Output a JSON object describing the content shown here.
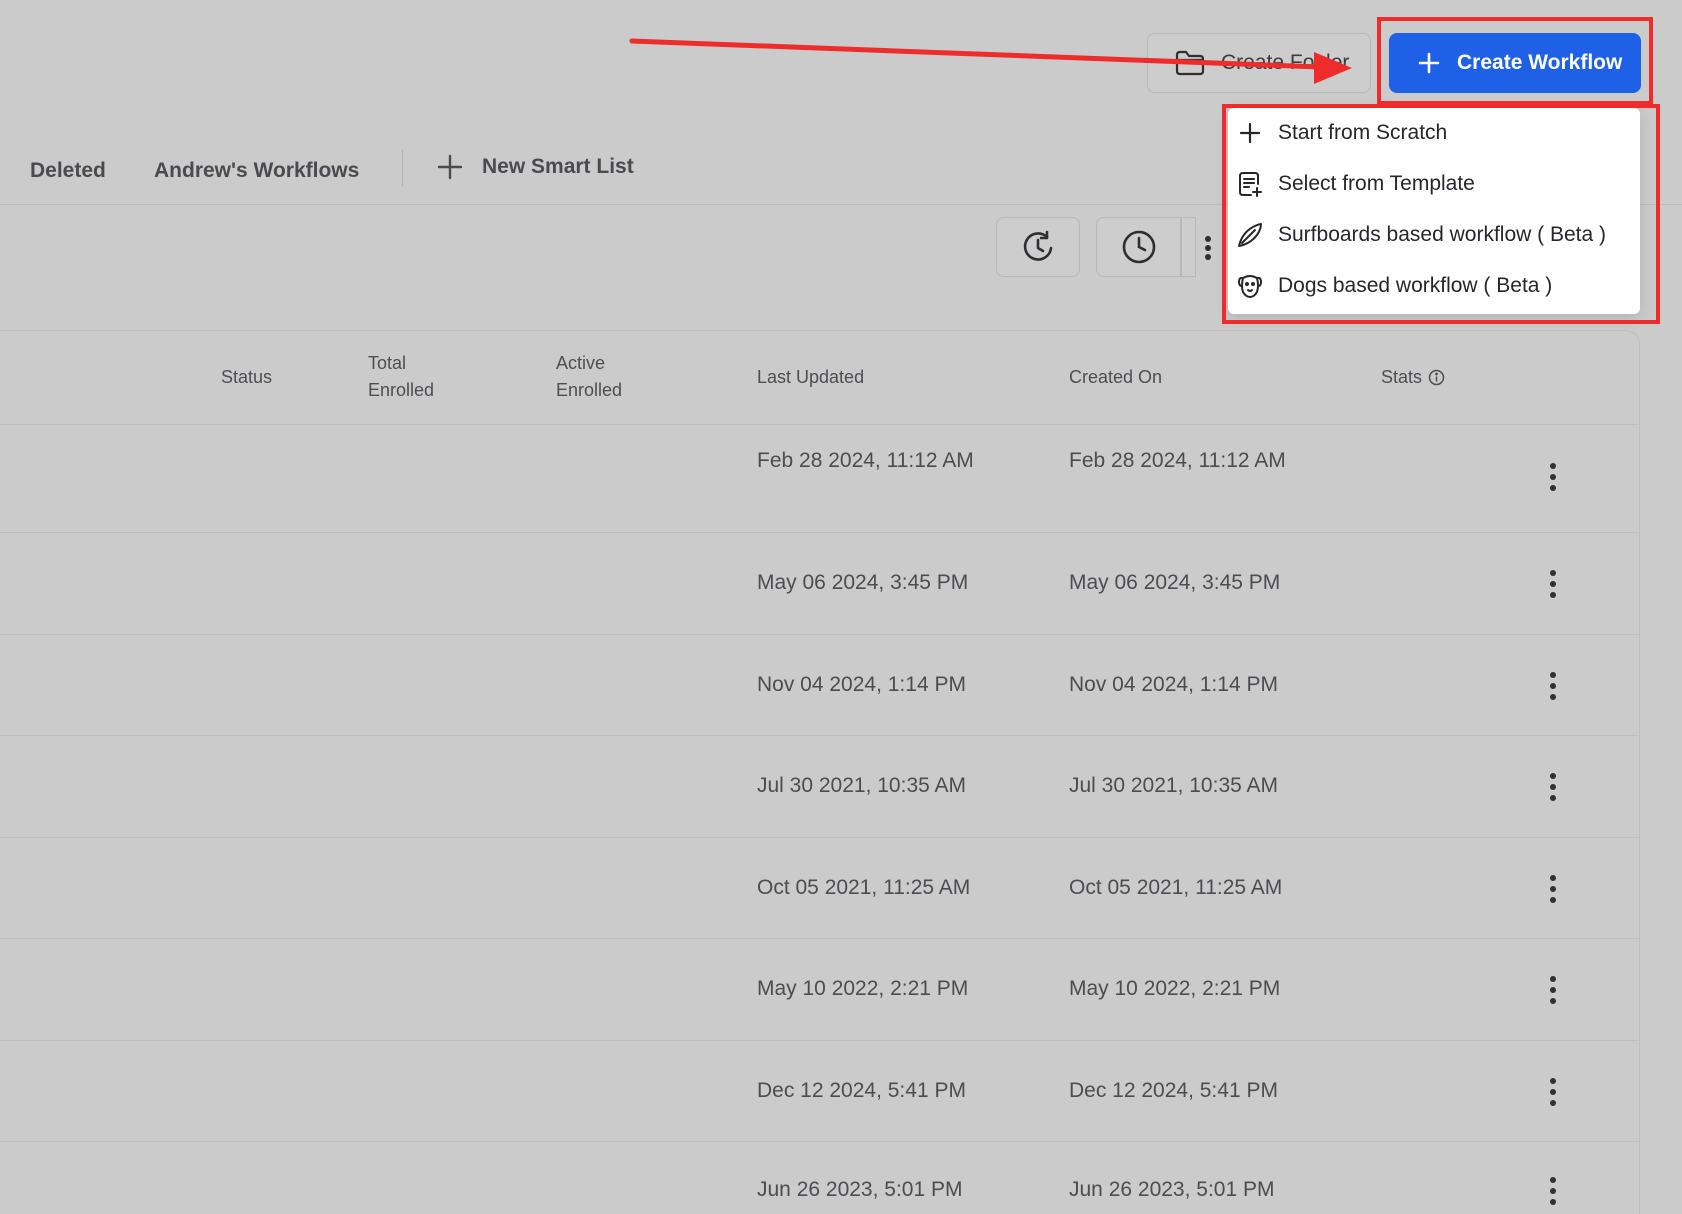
{
  "header": {
    "create_folder_label": "Create Folder",
    "create_workflow_label": "Create Workflow",
    "primary_color": "#1f61e6"
  },
  "tabs": {
    "items": [
      {
        "label": "Deleted"
      },
      {
        "label": "Andrew's Workflows"
      }
    ],
    "new_smart_list_label": "New Smart List"
  },
  "toolbar": {
    "icons": [
      "clock-refresh-icon",
      "clock-icon",
      "drag-handle-icon"
    ]
  },
  "table": {
    "columns": {
      "status": "Status",
      "total_enrolled_1": "Total",
      "total_enrolled_2": "Enrolled",
      "active_enrolled_1": "Active",
      "active_enrolled_2": "Enrolled",
      "last_updated": "Last Updated",
      "created_on": "Created On",
      "stats": "Stats"
    },
    "rows": [
      {
        "last_updated": "Feb 28 2024, 11:12 AM",
        "created_on": "Feb 28 2024, 11:12 AM"
      },
      {
        "last_updated": "May 06 2024, 3:45 PM",
        "created_on": "May 06 2024, 3:45 PM"
      },
      {
        "last_updated": "Nov 04 2024, 1:14 PM",
        "created_on": "Nov 04 2024, 1:14 PM"
      },
      {
        "last_updated": "Jul 30 2021, 10:35 AM",
        "created_on": "Jul 30 2021, 10:35 AM"
      },
      {
        "last_updated": "Oct 05 2021, 11:25 AM",
        "created_on": "Oct 05 2021, 11:25 AM"
      },
      {
        "last_updated": "May 10 2022, 2:21 PM",
        "created_on": "May 10 2022, 2:21 PM"
      },
      {
        "last_updated": "Dec 12 2024, 5:41 PM",
        "created_on": "Dec 12 2024, 5:41 PM"
      },
      {
        "last_updated": "Jun 26 2023, 5:01 PM",
        "created_on": "Jun 26 2023, 5:01 PM"
      }
    ]
  },
  "menu": {
    "items": [
      {
        "label": "Start from Scratch",
        "icon": "plus-icon"
      },
      {
        "label": "Select from Template",
        "icon": "template-icon"
      },
      {
        "label": "Surfboards based workflow ( Beta )",
        "icon": "surfboard-icon"
      },
      {
        "label": "Dogs based workflow ( Beta )",
        "icon": "dog-icon"
      }
    ]
  },
  "annotation": {
    "color": "#ee2c2c"
  }
}
